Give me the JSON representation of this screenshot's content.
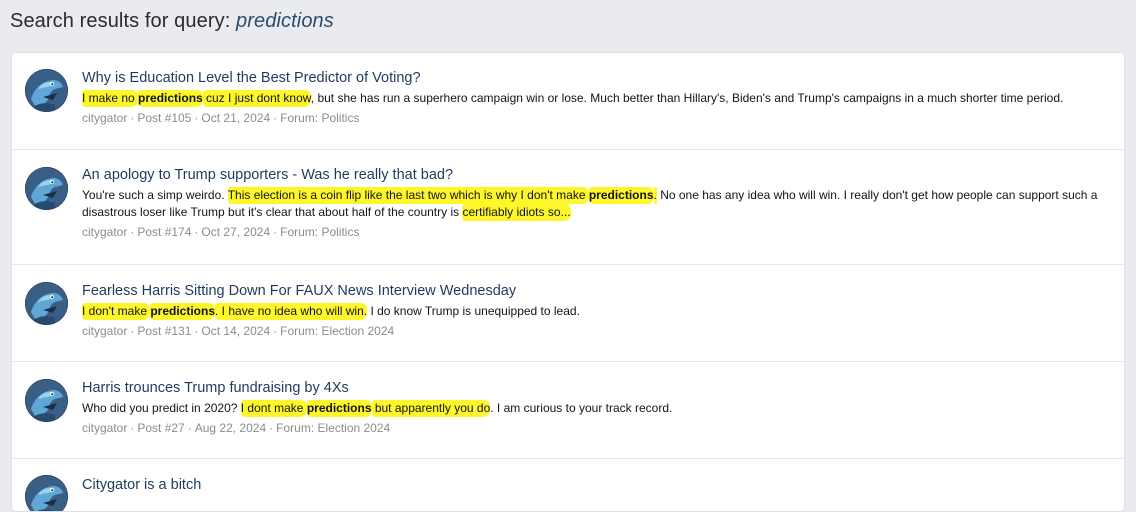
{
  "header": {
    "prefix": "Search results for query:",
    "query": "predictions"
  },
  "results": [
    {
      "title": "Why is Education Level the Best Predictor of Voting?",
      "snippet": [
        {
          "t": "I make no ",
          "hl": true
        },
        {
          "t": "predictions",
          "hl": true,
          "b": true
        },
        {
          "t": " cuz I just dont know",
          "hl": true
        },
        {
          "t": ", but she has run a superhero campaign win or lose. Much better than Hillary's, Biden's and Trump's campaigns in a much shorter time period."
        }
      ],
      "author": "citygator",
      "post": "Post #105",
      "date": "Oct 21, 2024",
      "forum": "Forum: Politics"
    },
    {
      "title": "An apology to Trump supporters - Was he really that bad?",
      "snippet": [
        {
          "t": "You're such a simp weirdo. "
        },
        {
          "t": "This election is a coin flip like the last two which is why I don't make ",
          "hl": true
        },
        {
          "t": "predictions",
          "hl": true,
          "b": true
        },
        {
          "t": ".",
          "hl": true
        },
        {
          "t": " No one has any idea who will win. I really don't get how people can support such a disastrous loser like Trump but it's clear that about half of the country is "
        },
        {
          "t": "certifiably idiots so...",
          "hl": true
        }
      ],
      "author": "citygator",
      "post": "Post #174",
      "date": "Oct 27, 2024",
      "forum": "Forum: Politics"
    },
    {
      "title": "Fearless Harris Sitting Down For FAUX News Interview Wednesday",
      "snippet": [
        {
          "t": "I don't make ",
          "hl": true
        },
        {
          "t": "predictions",
          "hl": true,
          "b": true
        },
        {
          "t": ". I have no idea who will win.",
          "hl": true
        },
        {
          "t": " I do know Trump is unequipped to lead."
        }
      ],
      "author": "citygator",
      "post": "Post #131",
      "date": "Oct 14, 2024",
      "forum": "Forum: Election 2024"
    },
    {
      "title": "Harris trounces Trump fundraising by 4Xs",
      "snippet": [
        {
          "t": "Who did you predict in 2020? "
        },
        {
          "t": "I dont make ",
          "hl": true
        },
        {
          "t": "predictions",
          "hl": true,
          "b": true
        },
        {
          "t": " but apparently you do",
          "hl": true
        },
        {
          "t": ". I am curious to your track record."
        }
      ],
      "author": "citygator",
      "post": "Post #27",
      "date": "Aug 22, 2024",
      "forum": "Forum: Election 2024"
    },
    {
      "title": "Citygator is a bitch",
      "snippet": [],
      "author": "",
      "post": "",
      "date": "",
      "forum": ""
    }
  ],
  "separator": "·"
}
